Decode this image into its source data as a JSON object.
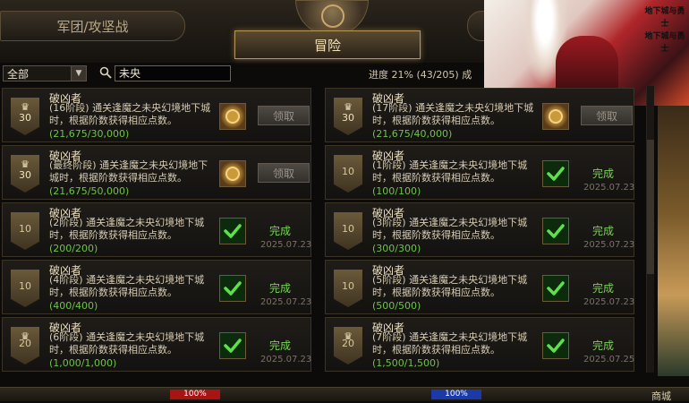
{
  "header": {
    "tab_left": "军团/攻坚战",
    "tab_main": "冒险"
  },
  "promo": {
    "logo_line1": "地下城与勇士",
    "logo_line2": "地下城与勇士"
  },
  "filter": {
    "category": "全部",
    "search_value": "未央",
    "progress": "进度  21% (43/205)  成"
  },
  "cards": [
    {
      "title": "破凶者",
      "desc": "(16阶段) 通关逢魔之未央幻境地下城时，根据阶数获得相应点数。",
      "count": "(21,675/30,000)",
      "points": "30",
      "status": "claim",
      "button": "领取",
      "date": ""
    },
    {
      "title": "破凶者",
      "desc": "(17阶段) 通关逢魔之未央幻境地下城时，根据阶数获得相应点数。",
      "count": "(21,675/40,000)",
      "points": "30",
      "status": "claim",
      "button": "领取",
      "date": ""
    },
    {
      "title": "破凶者",
      "desc": "(最终阶段) 通关逢魔之未央幻境地下城时，根据阶数获得相应点数。",
      "count": "(21,675/50,000)",
      "points": "30",
      "status": "claim",
      "button": "领取",
      "date": ""
    },
    {
      "title": "破凶者",
      "desc": "(1阶段) 通关逢魔之未央幻境地下城时，根据阶数获得相应点数。",
      "count": "(100/100)",
      "points": "10",
      "status": "done",
      "button": "完成",
      "date": "2025.07.23"
    },
    {
      "title": "破凶者",
      "desc": "(2阶段) 通关逢魔之未央幻境地下城时，根据阶数获得相应点数。",
      "count": "(200/200)",
      "points": "10",
      "status": "done",
      "button": "完成",
      "date": "2025.07.23"
    },
    {
      "title": "破凶者",
      "desc": "(3阶段) 通关逢魔之未央幻境地下城时，根据阶数获得相应点数。",
      "count": "(300/300)",
      "points": "10",
      "status": "done",
      "button": "完成",
      "date": "2025.07.23"
    },
    {
      "title": "破凶者",
      "desc": "(4阶段) 通关逢魔之未央幻境地下城时，根据阶数获得相应点数。",
      "count": "(400/400)",
      "points": "10",
      "status": "done",
      "button": "完成",
      "date": "2025.07.23"
    },
    {
      "title": "破凶者",
      "desc": "(5阶段) 通关逢魔之未央幻境地下城时，根据阶数获得相应点数。",
      "count": "(500/500)",
      "points": "10",
      "status": "done",
      "button": "完成",
      "date": "2025.07.23"
    },
    {
      "title": "破凶者",
      "desc": "(6阶段) 通关逢魔之未央幻境地下城时，根据阶数获得相应点数。",
      "count": "(1,000/1,000)",
      "points": "20",
      "status": "done",
      "button": "完成",
      "date": "2025.07.23"
    },
    {
      "title": "破凶者",
      "desc": "(7阶段) 通关逢魔之未央幻境地下城时，根据阶数获得相应点数。",
      "count": "(1,500/1,500)",
      "points": "20",
      "status": "done",
      "button": "完成",
      "date": "2025.07.25"
    }
  ],
  "bottom": {
    "hp": "100%",
    "mp": "100%",
    "town": "商城"
  },
  "colors": {
    "complete_green": "#7ad05a",
    "count_green": "#6ec24a",
    "accent_gold": "#b89858"
  }
}
